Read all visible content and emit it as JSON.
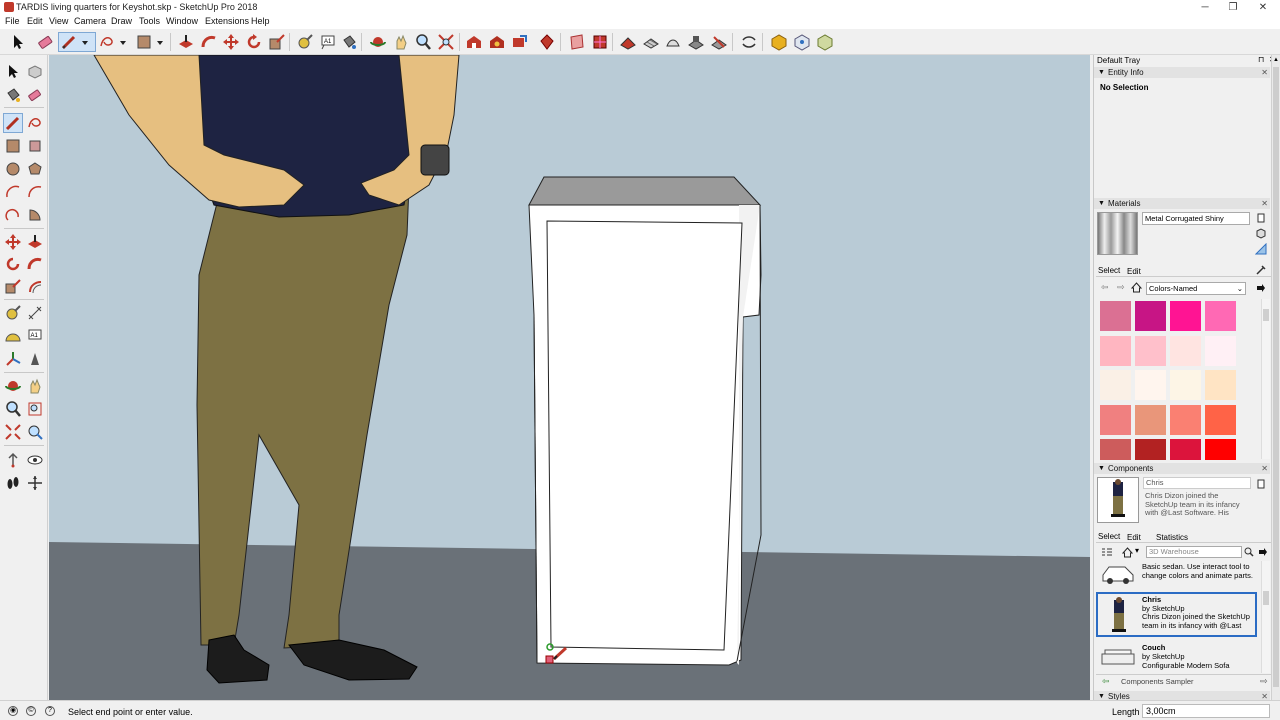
{
  "window": {
    "title": "TARDIS living quarters for Keyshot.skp - SketchUp Pro 2018",
    "minimize_glyph": "─",
    "maximize_glyph": "❐",
    "close_glyph": "✕"
  },
  "menu": [
    "File",
    "Edit",
    "View",
    "Camera",
    "Draw",
    "Tools",
    "Window",
    "Extensions",
    "Help"
  ],
  "tray": {
    "title": "Default Tray",
    "entity_info": {
      "header": "Entity Info",
      "selection": "No Selection"
    },
    "materials": {
      "header": "Materials",
      "material_name": "Metal Corrugated Shiny",
      "tab_select": "Select",
      "tab_edit": "Edit",
      "library": "Colors-Named",
      "swatches": [
        "#db7093",
        "#c71585",
        "#ff1493",
        "#ff69b4",
        "#ffb6c1",
        "#ffc0cb",
        "#ffe4e1",
        "#fff0f5",
        "#faf0e6",
        "#fff5ee",
        "#fdf5e6",
        "#ffe4c4",
        "#f08080",
        "#e9967a",
        "#fa8072",
        "#ff6347",
        "#cd5c5c",
        "#b22222",
        "#dc143c",
        "#ff0000"
      ]
    },
    "components": {
      "header": "Components",
      "selected_name": "Chris",
      "selected_desc": "Chris Dizon joined the SketchUp team in its infancy with @Last Software. His",
      "tab_select": "Select",
      "tab_edit": "Edit",
      "tab_statistics": "Statistics",
      "search_placeholder": "3D Warehouse",
      "items": [
        {
          "name": "",
          "by": "",
          "desc": "Basic sedan.  Use interact tool to change colors and animate parts."
        },
        {
          "name": "Chris",
          "by": "by SketchUp",
          "desc": "Chris Dizon joined the SketchUp team in its infancy with @Last So..."
        },
        {
          "name": "Couch",
          "by": "by SketchUp",
          "desc": "Configurable Modern Sofa"
        }
      ],
      "collection": "Components Sampler"
    },
    "styles": {
      "header": "Styles"
    }
  },
  "status": {
    "message": "Select end point or enter value.",
    "measure_label": "Length",
    "measure_value": "3,00cm"
  },
  "icons": {
    "top_toolbar": [
      "select-arrow-icon",
      "eraser-icon",
      "line-pencil-icon",
      "dropdown-arrow-icon",
      "freehand-icon",
      "dropdown-arrow-icon",
      "rectangle-icon",
      "dropdown-arrow-icon",
      "push-pull-icon",
      "follow-me-icon",
      "move-icon",
      "rotate-icon",
      "scale-icon",
      "tape-measure-icon",
      "text-label-icon",
      "paint-bucket-icon",
      "orbit-icon",
      "pan-icon",
      "zoom-icon",
      "zoom-extents-icon",
      "warehouse-icon",
      "extension-warehouse-icon",
      "share-model-icon",
      "layout-icon",
      "section-plane-icon",
      "section-fill-icon",
      "sandbox-from-contours-icon",
      "sandbox-from-scratch-icon",
      "smoove-icon",
      "stamp-icon",
      "drape-icon",
      "flip-edge-icon",
      "undo-redo-icon",
      "component-icon",
      "camera-position-icon",
      "advanced-camera-icon"
    ]
  }
}
